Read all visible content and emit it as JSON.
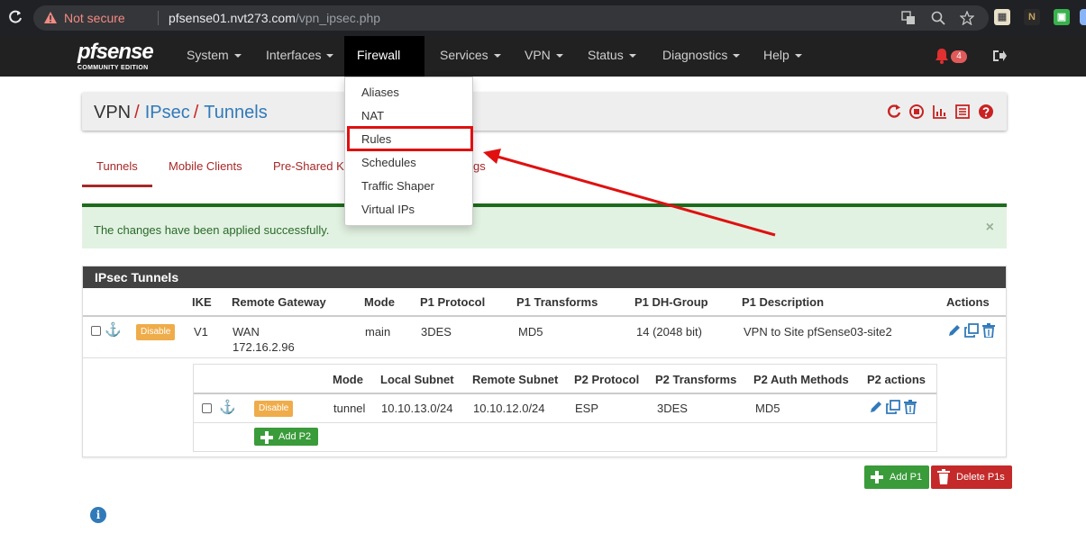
{
  "browser": {
    "security_label": "Not secure",
    "url_host": "pfsense01.nvt273.com",
    "url_path": "/vpn_ipsec.php"
  },
  "navbar": {
    "logo_text": "pfsense",
    "logo_edition": "COMMUNITY EDITION",
    "items": [
      {
        "label": "System"
      },
      {
        "label": "Interfaces"
      },
      {
        "label": "Firewall"
      },
      {
        "label": "Services"
      },
      {
        "label": "VPN"
      },
      {
        "label": "Status"
      },
      {
        "label": "Diagnostics"
      },
      {
        "label": "Help"
      }
    ],
    "notification_count": "4"
  },
  "firewall_menu": {
    "items": [
      {
        "label": "Aliases"
      },
      {
        "label": "NAT"
      },
      {
        "label": "Rules"
      },
      {
        "label": "Schedules"
      },
      {
        "label": "Traffic Shaper"
      },
      {
        "label": "Virtual IPs"
      }
    ]
  },
  "breadcrumb": {
    "root": "VPN",
    "level1": "IPsec",
    "level2": "Tunnels"
  },
  "tabs": [
    {
      "label": "Tunnels"
    },
    {
      "label": "Mobile Clients"
    },
    {
      "label": "Pre-Shared Ke"
    },
    {
      "label": "gs"
    }
  ],
  "alert": {
    "message": "The changes have been applied successfully.",
    "close": "×"
  },
  "tunnels": {
    "title": "IPsec Tunnels",
    "headers": [
      "IKE",
      "Remote Gateway",
      "Mode",
      "P1 Protocol",
      "P1 Transforms",
      "P1 DH-Group",
      "P1 Description",
      "Actions"
    ],
    "row": {
      "disable_label": "Disable",
      "ike": "V1",
      "gateway_iface": "WAN",
      "gateway_ip": "172.16.2.96",
      "mode": "main",
      "protocol": "3DES",
      "transforms": "MD5",
      "dh_group": "14 (2048 bit)",
      "description": "VPN to Site pfSense03-site2"
    },
    "p2": {
      "headers": [
        "Mode",
        "Local Subnet",
        "Remote Subnet",
        "P2 Protocol",
        "P2 Transforms",
        "P2 Auth Methods",
        "P2 actions"
      ],
      "row": {
        "disable_label": "Disable",
        "mode": "tunnel",
        "local_subnet": "10.10.13.0/24",
        "remote_subnet": "10.10.12.0/24",
        "protocol": "ESP",
        "transforms": "3DES",
        "auth": "MD5"
      },
      "add_label": "Add P2"
    }
  },
  "buttons": {
    "add_p1": "Add P1",
    "delete_p1s": "Delete P1s"
  },
  "colors": {
    "accent_red": "#a72828",
    "link_blue": "#317ab9",
    "success_green": "#1e6b1e",
    "annotation_red": "#e01010"
  }
}
